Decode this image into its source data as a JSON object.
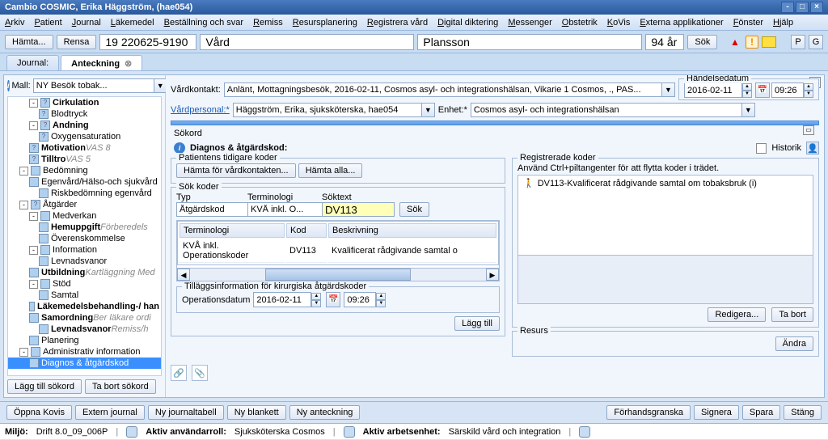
{
  "title": "Cambio COSMIC, Erika  Häggström, (hae054)",
  "menu": [
    "Arkiv",
    "Patient",
    "Journal",
    "Läkemedel",
    "Beställning och svar",
    "Remiss",
    "Resursplanering",
    "Registrera vård",
    "Digital diktering",
    "Messenger",
    "Obstetrik",
    "KoVis",
    "Externa applikationer",
    "Fönster",
    "Hjälp"
  ],
  "toolbar": {
    "hamta": "Hämta...",
    "rensa": "Rensa",
    "pnr": "19 220625-9190",
    "vard": "Vård",
    "name": "Plansson",
    "age": "94 år",
    "sok": "Sök",
    "p": "P",
    "g": "G"
  },
  "tabs": {
    "journal": "Journal:",
    "anteckning": "Anteckning"
  },
  "mall": {
    "label": "Mall:",
    "value": "NY Besök tobak..."
  },
  "tree": [
    {
      "lvl": 2,
      "exp": "-",
      "icon": "?",
      "text": "Cirkulation",
      "bold": true
    },
    {
      "lvl": 3,
      "icon": "?",
      "text": "Blodtryck"
    },
    {
      "lvl": 2,
      "exp": "-",
      "icon": "?",
      "text": "Andning",
      "bold": true
    },
    {
      "lvl": 3,
      "icon": "?",
      "text": "Oxygensaturation"
    },
    {
      "lvl": 2,
      "icon": "?",
      "text": "Motivation",
      "bold": true,
      "suffix": "VAS 8"
    },
    {
      "lvl": 2,
      "icon": "?",
      "text": "Tilltro",
      "bold": true,
      "suffix": "VAS 5"
    },
    {
      "lvl": 1,
      "exp": "-",
      "text": "Bedömning"
    },
    {
      "lvl": 2,
      "icon": "",
      "text": "Egenvård/Hälso-och sjukvård"
    },
    {
      "lvl": 3,
      "icon": "",
      "text": "Riskbedömning egenvård"
    },
    {
      "lvl": 1,
      "exp": "-",
      "icon": "?",
      "text": "Åtgärder"
    },
    {
      "lvl": 2,
      "exp": "-",
      "icon": "",
      "text": "Medverkan"
    },
    {
      "lvl": 3,
      "icon": "",
      "text": "Hemuppgift",
      "bold": true,
      "suffix": "Förberedels"
    },
    {
      "lvl": 3,
      "icon": "",
      "text": "Överenskommelse"
    },
    {
      "lvl": 2,
      "exp": "-",
      "icon": "",
      "text": "Information"
    },
    {
      "lvl": 3,
      "icon": "",
      "text": "Levnadsvanor"
    },
    {
      "lvl": 2,
      "icon": "",
      "text": "Utbildning",
      "bold": true,
      "suffix": "Kartläggning Med"
    },
    {
      "lvl": 2,
      "exp": "-",
      "icon": "",
      "text": "Stöd"
    },
    {
      "lvl": 3,
      "icon": "",
      "text": "Samtal"
    },
    {
      "lvl": 2,
      "icon": "",
      "text": "Läkemedelsbehandling-/ han",
      "bold": true
    },
    {
      "lvl": 2,
      "icon": "",
      "text": "Samordning",
      "bold": true,
      "suffix": "Ber läkare ordi"
    },
    {
      "lvl": 3,
      "icon": "",
      "text": "Levnadsvanor",
      "bold": true,
      "suffix": "Remiss/h"
    },
    {
      "lvl": 2,
      "icon": "",
      "text": "Planering"
    },
    {
      "lvl": 1,
      "exp": "-",
      "icon": "",
      "text": "Administrativ information"
    },
    {
      "lvl": 2,
      "icon": "",
      "text": "Diagnos & åtgärdskod",
      "selected": true
    }
  ],
  "leftBtns": {
    "add": "Lägg till sökord",
    "remove": "Ta bort sökord"
  },
  "form": {
    "vardkontakt_label": "Vårdkontakt:",
    "vardkontakt_value": "Anlänt, Mottagningsbesök, 2016-02-11, Cosmos asyl- och integrationshälsan, Vikarie 1 Cosmos, ., PAS...",
    "vardpersonal_label": "Vårdpersonal:*",
    "vardpersonal_value": "Häggström, Erika, sjuksköterska, hae054",
    "enhet_label": "Enhet:*",
    "enhet_value": "Cosmos asyl- och integrationshälsan",
    "handelsedatum_label": "Händelsedatum",
    "date": "2016-02-11",
    "time": "09:26"
  },
  "sokord": {
    "title": "Sökord",
    "heading": "Diagnos & åtgärdskod:",
    "historik": "Historik",
    "patientens": "Patientens tidigare koder",
    "hamta_kontakt": "Hämta för vårdkontakten...",
    "hamta_alla": "Hämta alla...",
    "sok_koder": "Sök koder",
    "typ": "Typ",
    "typ_value": "Åtgärdskod",
    "terminologi": "Terminologi",
    "terminologi_value": "KVÅ inkl. O...",
    "soktext": "Söktext",
    "soktext_value": "DV113",
    "sok": "Sök",
    "table_headers": [
      "Terminologi",
      "Kod",
      "Beskrivning"
    ],
    "table_row": [
      "KVÅ inkl. Operationskoder",
      "DV113",
      "Kvalificerat rådgivande samtal o"
    ],
    "tillagg": "Tilläggsinformation för kirurgiska åtgärdskoder",
    "opdatum": "Operationsdatum",
    "op_date": "2016-02-11",
    "op_time": "09:26",
    "lagg_till": "Lägg till",
    "registrerade": "Registrerade koder",
    "reg_hint": "Använd Ctrl+piltangenter för att flytta koder i trädet.",
    "reg_item": "DV113-Kvalificerat rådgivande samtal om tobaksbruk (i)",
    "redigera": "Redigera...",
    "tabort": "Ta bort",
    "resurs": "Resurs",
    "andra": "Ändra"
  },
  "bottom": {
    "oppna_kovis": "Öppna Kovis",
    "extern": "Extern journal",
    "ny_tabell": "Ny journaltabell",
    "ny_blankett": "Ny blankett",
    "ny_anteckning": "Ny anteckning",
    "forhands": "Förhandsgranska",
    "signera": "Signera",
    "spara": "Spara",
    "stang": "Stäng"
  },
  "status": {
    "miljo_label": "Miljö:",
    "miljo_value": "Drift 8.0_09_006P",
    "roll_label": "Aktiv användarroll:",
    "roll_value": "Sjuksköterska Cosmos",
    "enhet_label": "Aktiv arbetsenhet:",
    "enhet_value": "Särskild vård och integration"
  }
}
